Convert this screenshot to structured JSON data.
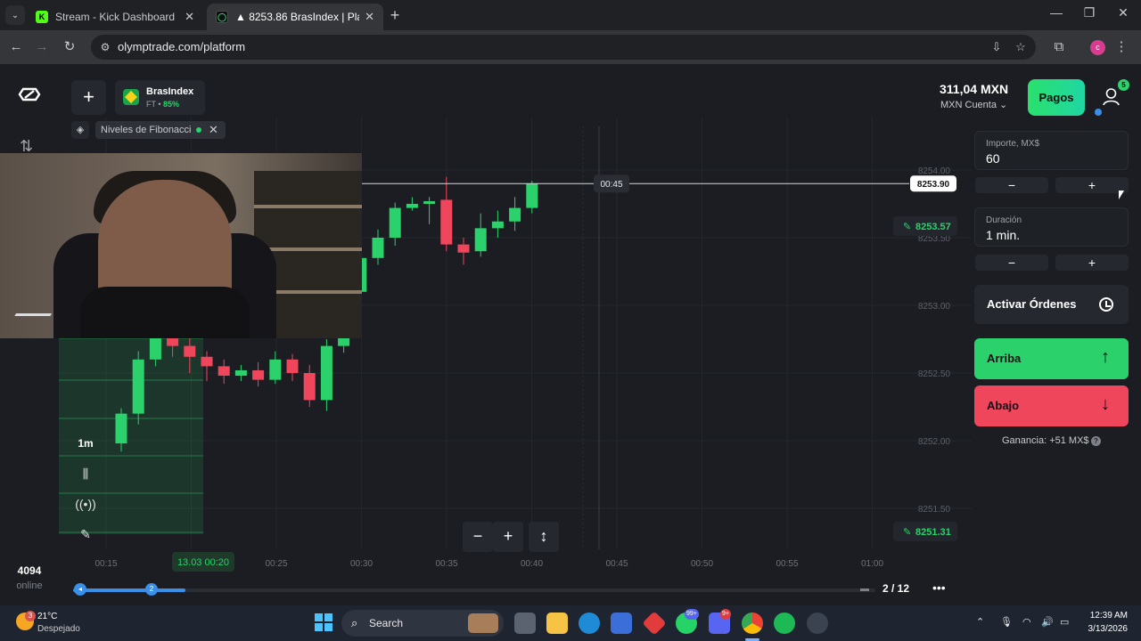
{
  "browser": {
    "tabs": [
      {
        "title": "Stream - Kick Dashboard",
        "favicon": "kick-icon"
      },
      {
        "title": "▲ 8253.86 BrasIndex | Plataform",
        "favicon": "olymptrade-icon"
      }
    ],
    "url": "olymptrade.com/platform",
    "profile_initial": "c"
  },
  "platform": {
    "asset": {
      "name": "BrasIndex",
      "sub_prefix": "FT •",
      "payout": "85%"
    },
    "indicator": {
      "name": "Niveles de Fibonacci"
    },
    "sidebar": {
      "online_count": "4094",
      "online_label": "online"
    },
    "chart_tools": {
      "timeframe": "1m"
    },
    "pagination": "2 / 12",
    "chart": {
      "current_price": "8253.90",
      "timer": "00:45",
      "price_labels": [
        "8254.00",
        "8253.50",
        "8253.00",
        "8252.50",
        "8252.00",
        "8251.50"
      ],
      "upper_line": "8253.57",
      "lower_line": "8251.31",
      "time_labels": [
        "00:15",
        "00:20",
        "00:25",
        "00:30",
        "00:35",
        "00:40",
        "00:45",
        "00:50",
        "00:55",
        "01:00"
      ],
      "time_highlight": "13.03 00:20"
    },
    "account": {
      "balance": "311,04 MXN",
      "account_name": "MXN Cuenta",
      "notifications": "5"
    },
    "payments_label": "Pagos",
    "amount": {
      "label": "Importe, MX$",
      "value": "60"
    },
    "duration": {
      "label": "Duración",
      "value": "1 min."
    },
    "orders_label": "Activar Órdenes",
    "up_label": "Arriba",
    "down_label": "Abajo",
    "gain_label": "Ganancia: +51 MX$"
  },
  "candles": [
    [
      8251.98,
      8252.2,
      8251.92,
      8252.24,
      "up"
    ],
    [
      8252.2,
      8252.6,
      8252.12,
      8252.66,
      "up"
    ],
    [
      8252.6,
      8253.0,
      8252.55,
      8253.08,
      "up"
    ],
    [
      8252.85,
      8252.7,
      8252.62,
      8252.92,
      "down"
    ],
    [
      8252.7,
      8252.62,
      8252.5,
      8252.76,
      "down"
    ],
    [
      8252.62,
      8252.55,
      8252.44,
      8252.66,
      "down"
    ],
    [
      8252.55,
      8252.48,
      8252.42,
      8252.6,
      "down"
    ],
    [
      8252.48,
      8252.52,
      8252.44,
      8252.56,
      "up"
    ],
    [
      8252.52,
      8252.45,
      8252.4,
      8252.58,
      "down"
    ],
    [
      8252.45,
      8252.6,
      8252.42,
      8252.66,
      "up"
    ],
    [
      8252.6,
      8252.5,
      8252.44,
      8252.64,
      "down"
    ],
    [
      8252.5,
      8252.3,
      8252.25,
      8252.56,
      "down"
    ],
    [
      8252.3,
      8252.7,
      8252.22,
      8252.75,
      "up"
    ],
    [
      8252.7,
      8253.1,
      8252.65,
      8253.15,
      "up"
    ],
    [
      8253.1,
      8253.35,
      8253.05,
      8253.55,
      "up"
    ],
    [
      8253.35,
      8253.5,
      8253.3,
      8253.56,
      "up"
    ],
    [
      8253.5,
      8253.72,
      8253.44,
      8253.76,
      "up"
    ],
    [
      8253.72,
      8253.75,
      8253.7,
      8253.8,
      "up"
    ],
    [
      8253.75,
      8253.77,
      8253.6,
      8253.8,
      "up"
    ],
    [
      8253.78,
      8253.45,
      8253.4,
      8253.95,
      "down"
    ],
    [
      8253.45,
      8253.39,
      8253.3,
      8253.5,
      "down"
    ],
    [
      8253.4,
      8253.57,
      8253.36,
      8253.68,
      "up"
    ],
    [
      8253.57,
      8253.62,
      8253.5,
      8253.7,
      "up"
    ],
    [
      8253.62,
      8253.72,
      8253.55,
      8253.8,
      "up"
    ],
    [
      8253.72,
      8253.9,
      8253.68,
      8253.92,
      "up"
    ]
  ],
  "colors": {
    "up": "#2bd26b",
    "down": "#f0465c",
    "accent": "#3a8fe8"
  },
  "taskbar": {
    "weather_temp": "21°C",
    "weather_desc": "Despejado",
    "weather_badge": "3",
    "search": "Search",
    "whatsapp_badge": "99+",
    "discord_badge": "9+",
    "time": "12:39 AM",
    "date": "3/13/2026"
  }
}
